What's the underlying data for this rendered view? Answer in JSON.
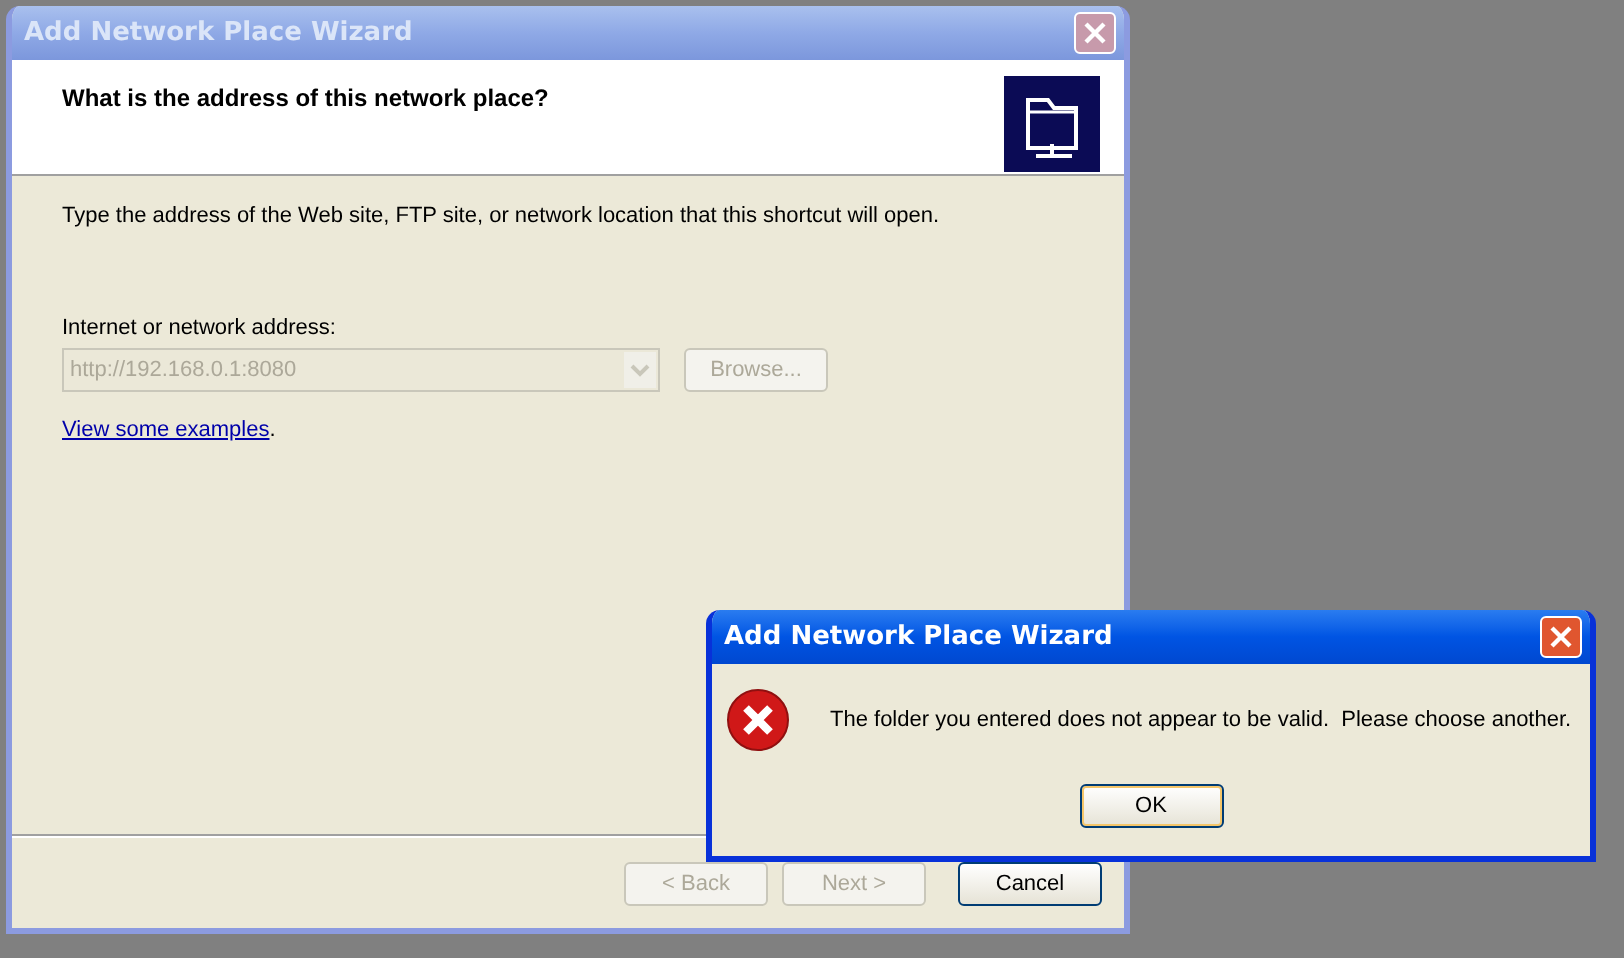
{
  "main_window": {
    "title": "Add Network Place Wizard",
    "active": false,
    "heading": "What is the address of this network place?",
    "instruction": "Type the address of the Web site, FTP site, or network location that this shortcut will open.",
    "address_field": {
      "label": "Internet or network address:",
      "value": "http://192.168.0.1:8080",
      "disabled": true
    },
    "browse_button": {
      "label": "Browse...",
      "disabled": true
    },
    "examples_link": "View some examples",
    "examples_suffix": ".",
    "buttons": [
      {
        "label": "< Back",
        "disabled": true
      },
      {
        "label": "Next >",
        "disabled": true
      },
      {
        "label": "Cancel",
        "disabled": false
      }
    ]
  },
  "error_dialog": {
    "title": "Add Network Place Wizard",
    "active": true,
    "message": "The folder you entered does not appear to be valid.  Please choose another.",
    "ok_button": "OK"
  }
}
